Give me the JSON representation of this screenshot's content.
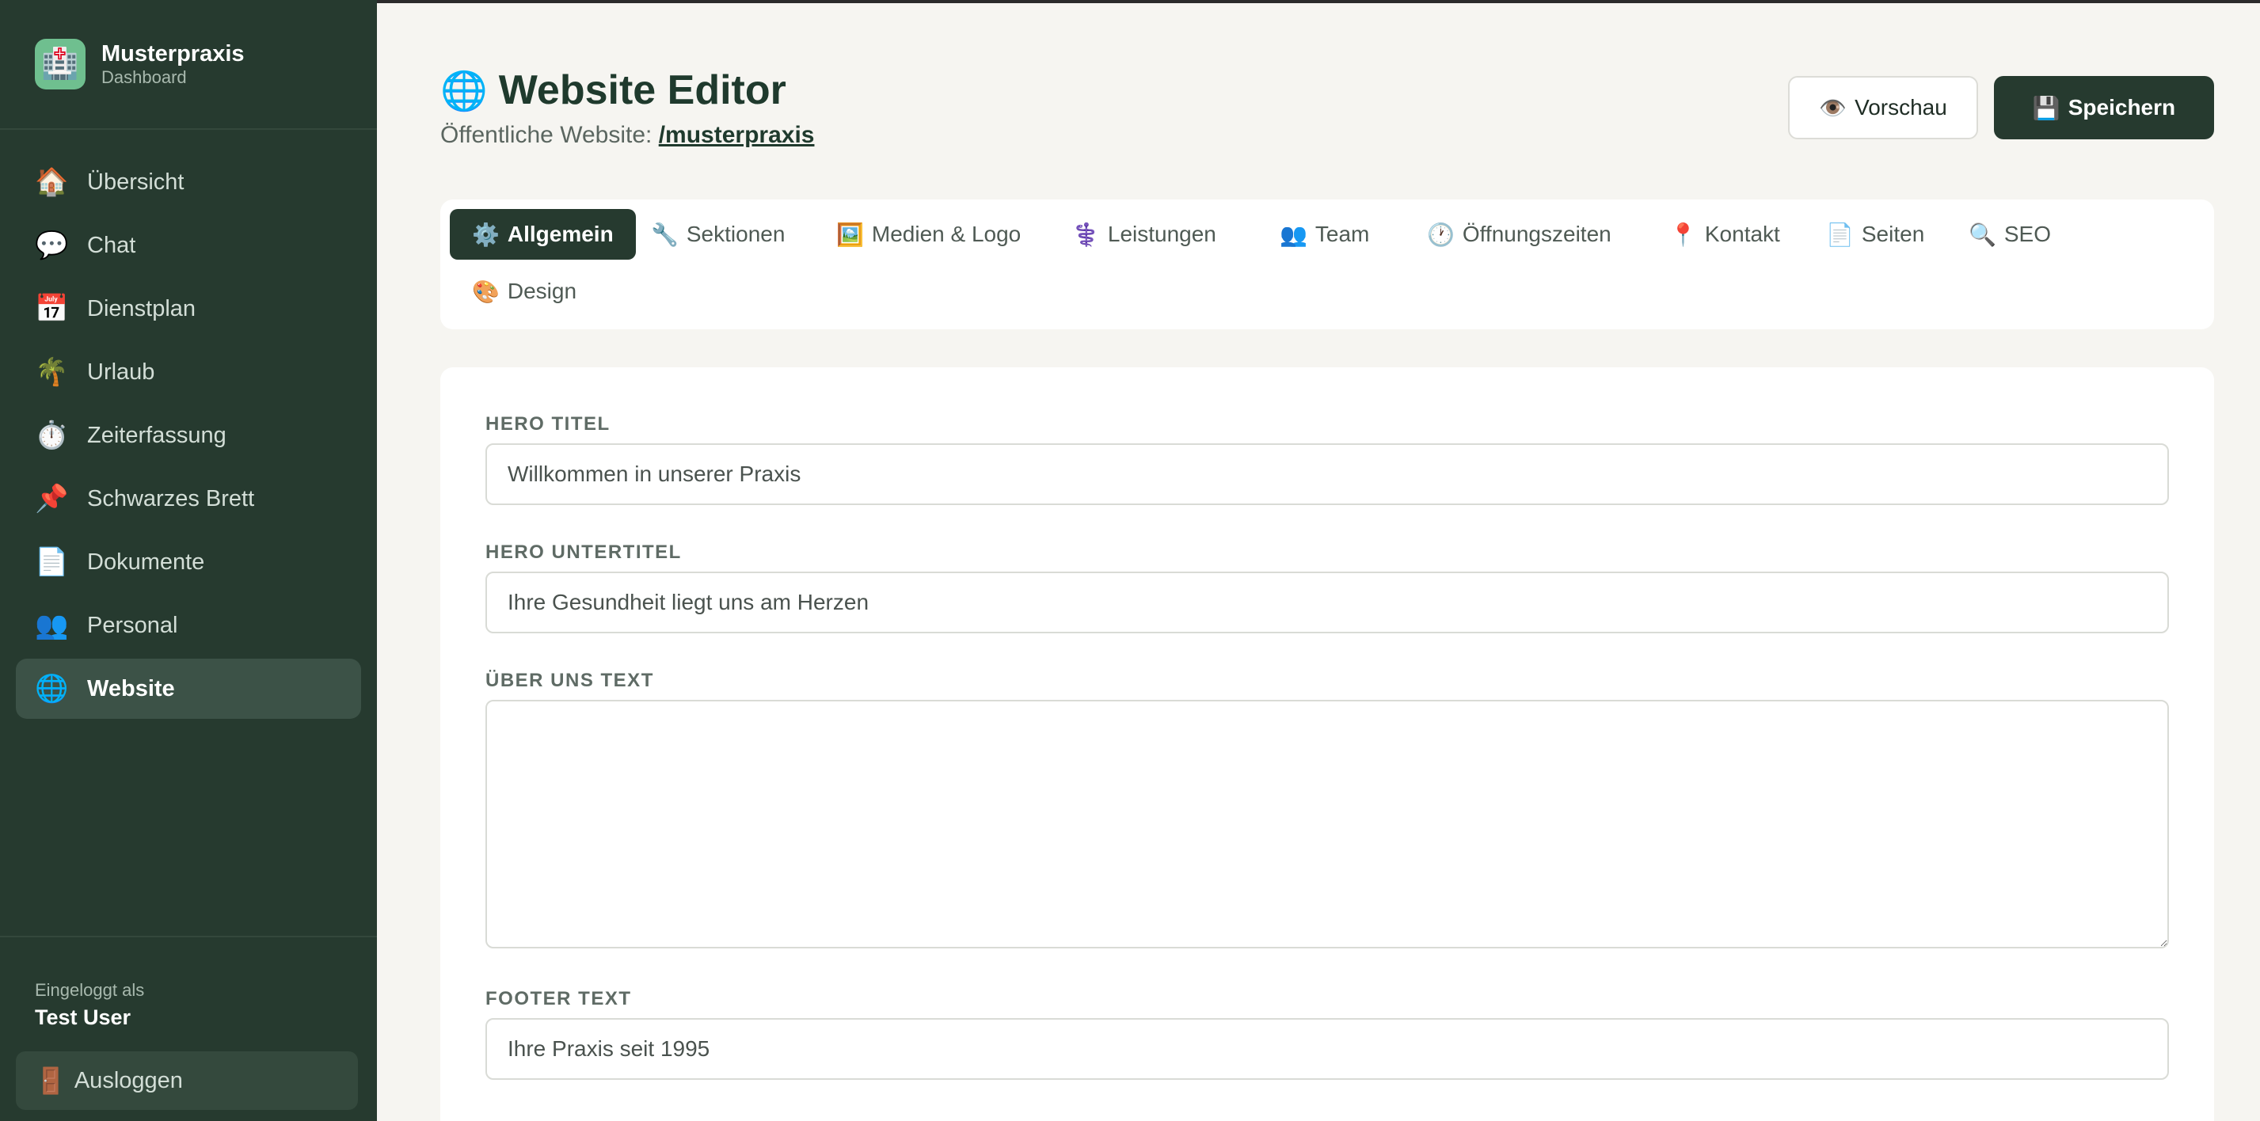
{
  "sidebar": {
    "brand": {
      "name": "Musterpraxis",
      "subtitle": "Dashboard",
      "icon": "🏥"
    },
    "items": [
      {
        "icon": "🏠",
        "icon_name": "house-icon",
        "label": "Übersicht",
        "active": false
      },
      {
        "icon": "💬",
        "icon_name": "chat-bubble-icon",
        "label": "Chat",
        "active": false
      },
      {
        "icon": "📅",
        "icon_name": "calendar-icon",
        "label": "Dienstplan",
        "active": false
      },
      {
        "icon": "🌴",
        "icon_name": "palm-tree-icon",
        "label": "Urlaub",
        "active": false
      },
      {
        "icon": "⏱️",
        "icon_name": "stopwatch-icon",
        "label": "Zeiterfassung",
        "active": false
      },
      {
        "icon": "📌",
        "icon_name": "pushpin-icon",
        "label": "Schwarzes Brett",
        "active": false
      },
      {
        "icon": "📄",
        "icon_name": "document-icon",
        "label": "Dokumente",
        "active": false
      },
      {
        "icon": "👥",
        "icon_name": "people-icon",
        "label": "Personal",
        "active": false
      },
      {
        "icon": "🌐",
        "icon_name": "globe-icon",
        "label": "Website",
        "active": true
      }
    ],
    "footer": {
      "logged_in_label": "Eingeloggt als",
      "user_name": "Test User",
      "logout_icon": "🚪",
      "logout_label": "Ausloggen"
    }
  },
  "header": {
    "title_icon": "🌐",
    "title": "Website Editor",
    "public_site_label": "Öffentliche Website:",
    "public_site_link": "/musterpraxis",
    "preview_icon": "👁️",
    "preview_label": "Vorschau",
    "save_icon": "💾",
    "save_label": "Speichern"
  },
  "tabs": [
    {
      "icon": "⚙️",
      "icon_name": "gear-icon",
      "label": "Allgemein",
      "active": true
    },
    {
      "icon": "🔧",
      "icon_name": "wrench-icon",
      "label": "Sektionen",
      "active": false
    },
    {
      "icon": "🖼️",
      "icon_name": "picture-icon",
      "label": "Medien & Logo",
      "active": false
    },
    {
      "icon": "⚕️",
      "icon_name": "medical-staff-icon",
      "label": "Leistungen",
      "active": false
    },
    {
      "icon": "👥",
      "icon_name": "people-icon",
      "label": "Team",
      "active": false
    },
    {
      "icon": "🕐",
      "icon_name": "clock-icon",
      "label": "Öffnungszeiten",
      "active": false
    },
    {
      "icon": "📍",
      "icon_name": "location-pin-icon",
      "label": "Kontakt",
      "active": false
    },
    {
      "icon": "📄",
      "icon_name": "page-icon",
      "label": "Seiten",
      "active": false
    },
    {
      "icon": "🔍",
      "icon_name": "magnifier-icon",
      "label": "SEO",
      "active": false
    },
    {
      "icon": "🎨",
      "icon_name": "palette-icon",
      "label": "Design",
      "active": false
    }
  ],
  "form": {
    "hero_title": {
      "label": "HERO TITEL",
      "value": "Willkommen in unserer Praxis"
    },
    "hero_subtitle": {
      "label": "HERO UNTERTITEL",
      "value": "Ihre Gesundheit liegt uns am Herzen"
    },
    "about_text": {
      "label": "ÜBER UNS TEXT",
      "value": ""
    },
    "footer_text": {
      "label": "FOOTER TEXT",
      "value": "Ihre Praxis seit 1995"
    }
  },
  "colors": {
    "sidebar_bg": "#263a2f",
    "accent": "#263a2f",
    "page_bg": "#f6f5f1",
    "card_bg": "#ffffff"
  }
}
